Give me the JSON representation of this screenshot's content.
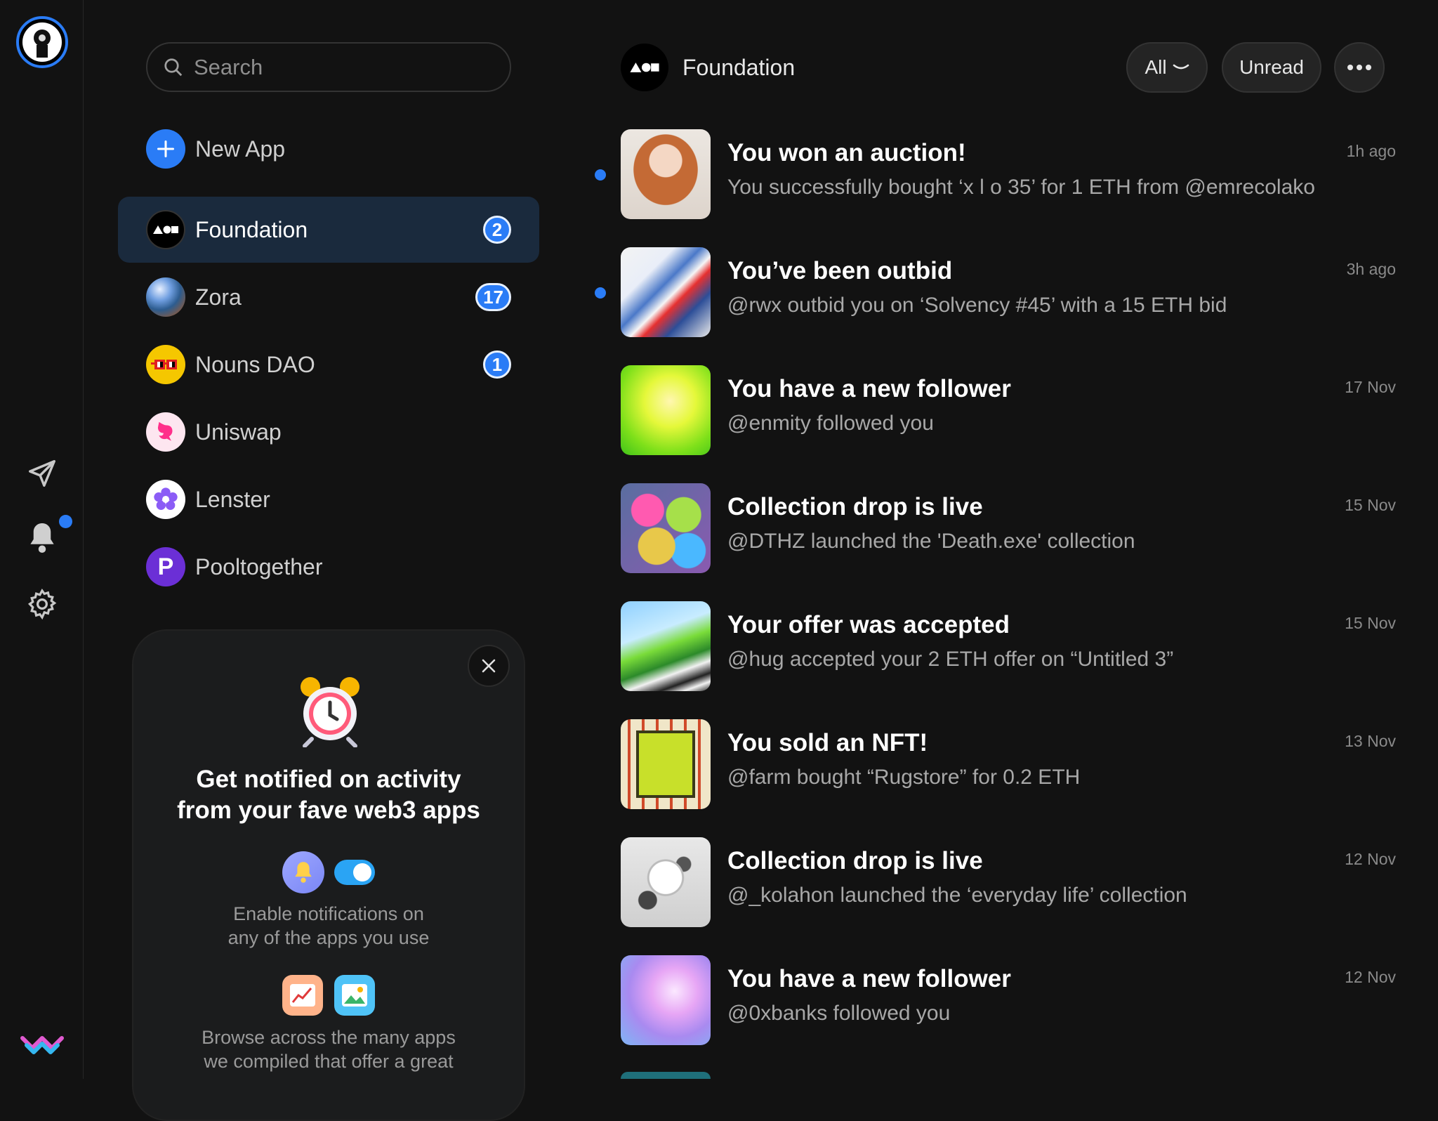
{
  "colors": {
    "accent": "#2a7cf6",
    "background": "#121212",
    "active_row": "#1a2a3d"
  },
  "rail": {
    "avatar_icon": "user-avatar",
    "icons": [
      "send-icon",
      "bell-icon",
      "gear-icon",
      "walletconnect-logo"
    ]
  },
  "search": {
    "placeholder": "Search"
  },
  "new_app": {
    "label": "New App"
  },
  "apps": [
    {
      "label": "Foundation",
      "badge": "2",
      "icon": "foundation-logo"
    },
    {
      "label": "Zora",
      "badge": "17",
      "icon": "zora-logo"
    },
    {
      "label": "Nouns DAO",
      "badge": "1",
      "icon": "nouns-logo"
    },
    {
      "label": "Uniswap",
      "badge": "",
      "icon": "uniswap-logo"
    },
    {
      "label": "Lenster",
      "badge": "",
      "icon": "lenster-logo"
    },
    {
      "label": "Pooltogether",
      "badge": "",
      "icon": "pooltogether-logo"
    }
  ],
  "promo": {
    "title_line1": "Get notified on activity",
    "title_line2": "from your fave web3 apps",
    "text1_line1": "Enable notifications on",
    "text1_line2": "any of the apps you use",
    "text2_line1": "Browse across the many apps",
    "text2_line2": "we compiled that offer a great"
  },
  "header": {
    "title": "Foundation",
    "filter_all": "All",
    "filter_unread": "Unread"
  },
  "notifications": [
    {
      "title": "You won an auction!",
      "text": "You successfully bought ‘x l o 35’ for 1 ETH from @emrecolako",
      "time": "1h ago",
      "unread": true
    },
    {
      "title": "You’ve been outbid",
      "text": "@rwx outbid you on ‘Solvency #45’ with a 15 ETH bid",
      "time": "3h ago",
      "unread": true
    },
    {
      "title": "You have a new follower",
      "text": "@enmity followed you",
      "time": "17 Nov",
      "unread": false
    },
    {
      "title": "Collection drop is live",
      "text": "@DTHZ launched the 'Death.exe' collection",
      "time": "15 Nov",
      "unread": false
    },
    {
      "title": "Your offer was accepted",
      "text": "@hug accepted your 2 ETH offer on “Untitled 3”",
      "time": "15 Nov",
      "unread": false
    },
    {
      "title": "You sold an NFT!",
      "text": "@farm bought “Rugstore” for 0.2 ETH",
      "time": "13 Nov",
      "unread": false
    },
    {
      "title": "Collection drop is live",
      "text": "@_kolahon launched the ‘everyday life’ collection",
      "time": "12 Nov",
      "unread": false
    },
    {
      "title": "You have a new follower",
      "text": "@0xbanks followed you",
      "time": "12 Nov",
      "unread": false
    }
  ]
}
